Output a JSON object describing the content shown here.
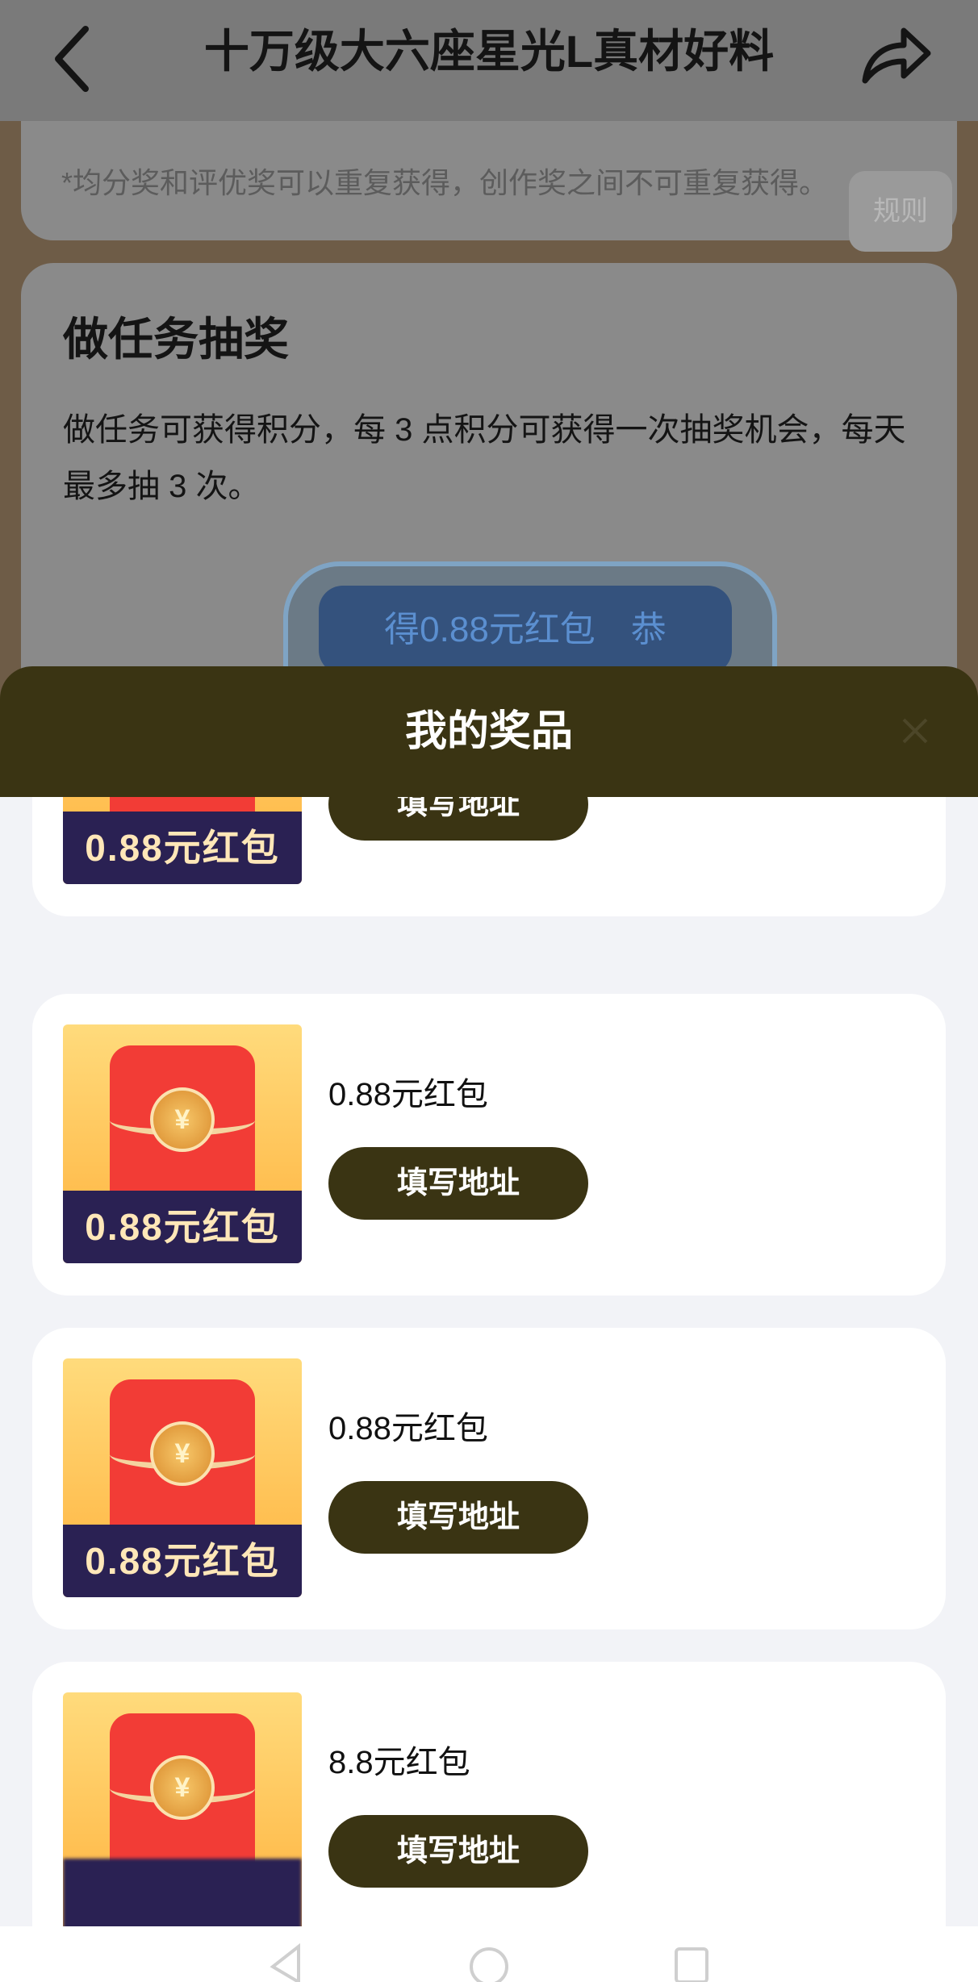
{
  "header": {
    "title": "十万级大六座星光L真材好料",
    "back_icon": "chevron-left-icon",
    "share_icon": "share-arrow-icon"
  },
  "rules_card": {
    "note": "*均分奖和评优奖可以重复获得，创作奖之间不可重复获得。",
    "rule_button": "规则"
  },
  "task_card": {
    "heading": "做任务抽奖",
    "description": "做任务可获得积分，每 3 点积分可获得一次抽奖机会，每天最多抽 3 次。",
    "ticker": "得0.88元红包　恭"
  },
  "modal": {
    "title": "我的奖品",
    "close_icon": "close-icon",
    "accent": "#3a3413",
    "prizes": [
      {
        "name": "",
        "thumb_label": "0.88元红包",
        "button": "填写地址"
      },
      {
        "name": "0.88元红包",
        "thumb_label": "0.88元红包",
        "button": "填写地址"
      },
      {
        "name": "0.88元红包",
        "thumb_label": "0.88元红包",
        "button": "填写地址"
      },
      {
        "name": "8.8元红包",
        "thumb_label": "",
        "button": "填写地址"
      }
    ]
  }
}
